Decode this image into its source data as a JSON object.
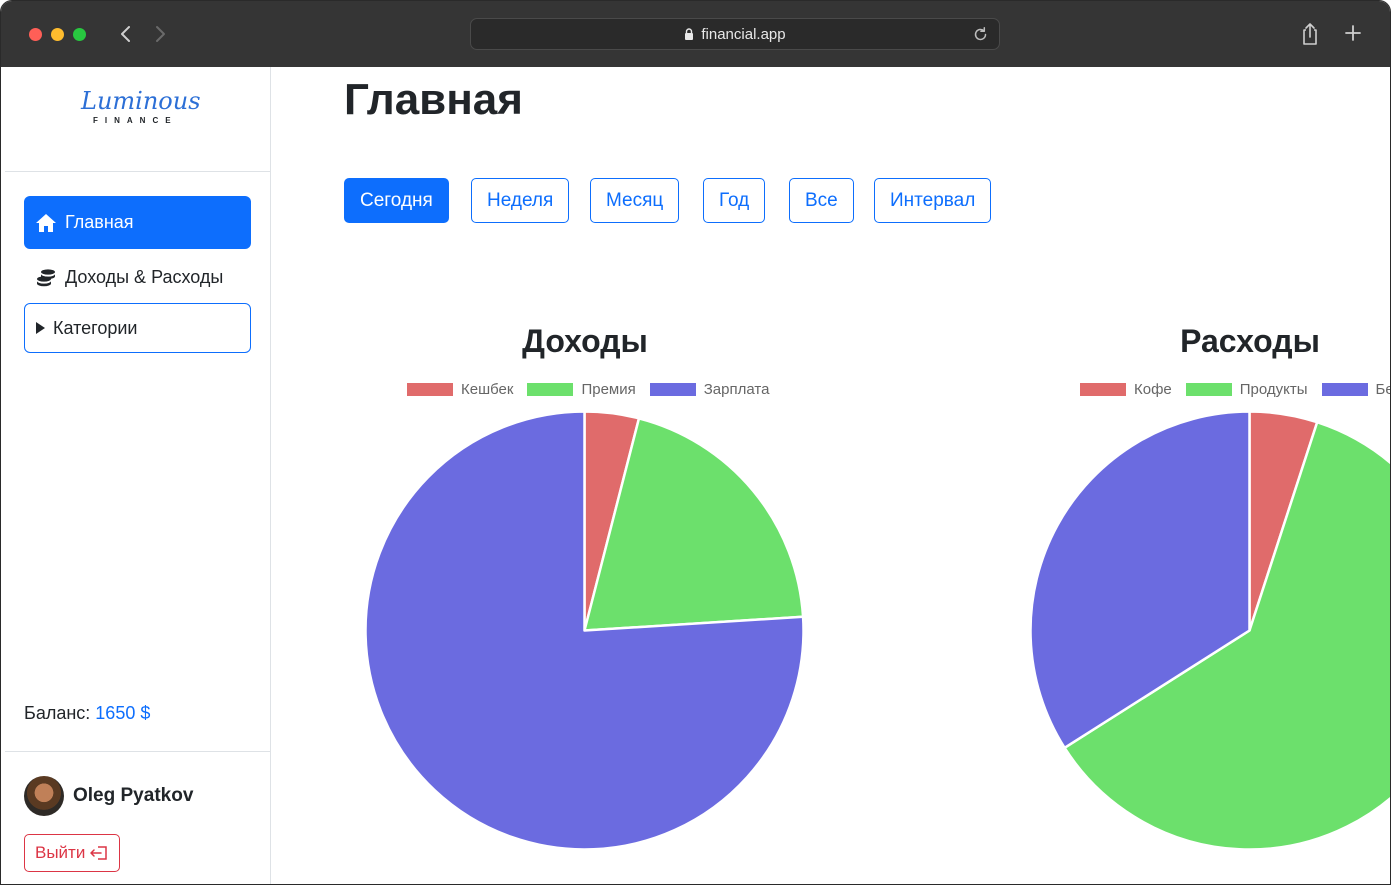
{
  "browser": {
    "url": "financial.app"
  },
  "logo": {
    "script": "Luminous",
    "subtitle": "FINANCE"
  },
  "sidebar": {
    "items": [
      {
        "label": "Главная",
        "icon": "home-icon"
      },
      {
        "label": "Доходы & Расходы",
        "icon": "coins-icon"
      },
      {
        "label": "Категории",
        "icon": "caret-right-icon"
      }
    ],
    "balance_label": "Баланс:",
    "balance_value": "1650 $",
    "user_name": "Oleg Pyatkov",
    "logout_label": "Выйти"
  },
  "main": {
    "title": "Главная",
    "periods": [
      "Сегодня",
      "Неделя",
      "Месяц",
      "Год",
      "Все",
      "Интервал"
    ],
    "active_period": "Сегодня"
  },
  "colors": {
    "primary": "#0d6efd",
    "danger": "#dc3545",
    "red": "#e06b6b",
    "green": "#6ce06c",
    "blue": "#6b6be0"
  },
  "chart_data": [
    {
      "type": "pie",
      "title": "Доходы",
      "labels": [
        "Кешбек",
        "Премия",
        "Зарплата"
      ],
      "values": [
        4,
        20,
        76
      ],
      "colors": [
        "#e06b6b",
        "#6ce06c",
        "#6b6be0"
      ],
      "legend": "top"
    },
    {
      "type": "pie",
      "title": "Расходы",
      "labels": [
        "Кофе",
        "Продукты",
        "Бе"
      ],
      "values": [
        5,
        61,
        34
      ],
      "colors": [
        "#e06b6b",
        "#6ce06c",
        "#6b6be0"
      ],
      "legend": "top"
    }
  ]
}
